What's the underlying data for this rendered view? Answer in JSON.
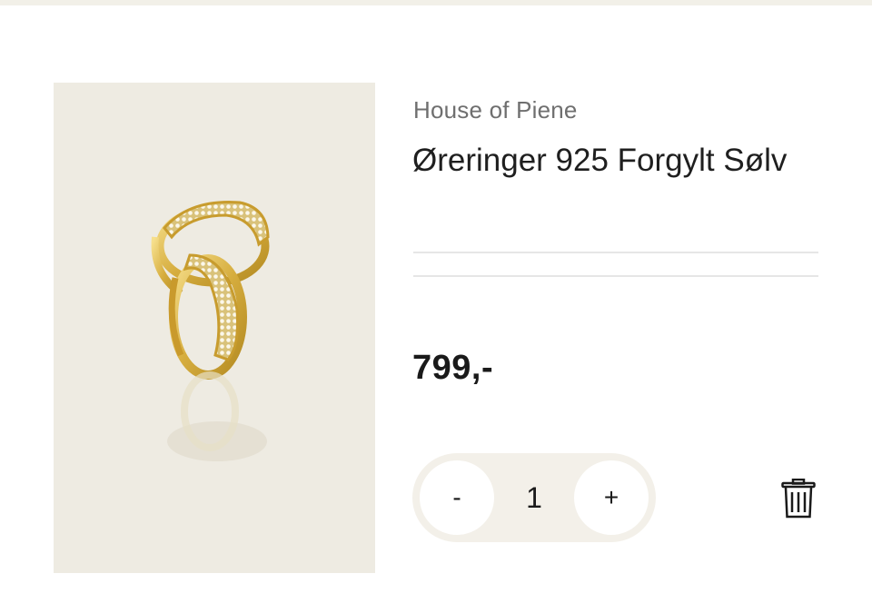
{
  "product": {
    "brand": "House of Piene",
    "title": "Øreringer 925 Forgylt Sølv",
    "price": "799,-",
    "image_icon": "gold-hoop-earrings-image"
  },
  "quantity": {
    "decrement_label": "-",
    "value": "1",
    "increment_label": "+"
  },
  "actions": {
    "remove_icon": "trash-icon"
  },
  "colors": {
    "image_background": "#eeebe2",
    "qty_pill": "#f3f0e9",
    "gold": "#d8b24a"
  }
}
